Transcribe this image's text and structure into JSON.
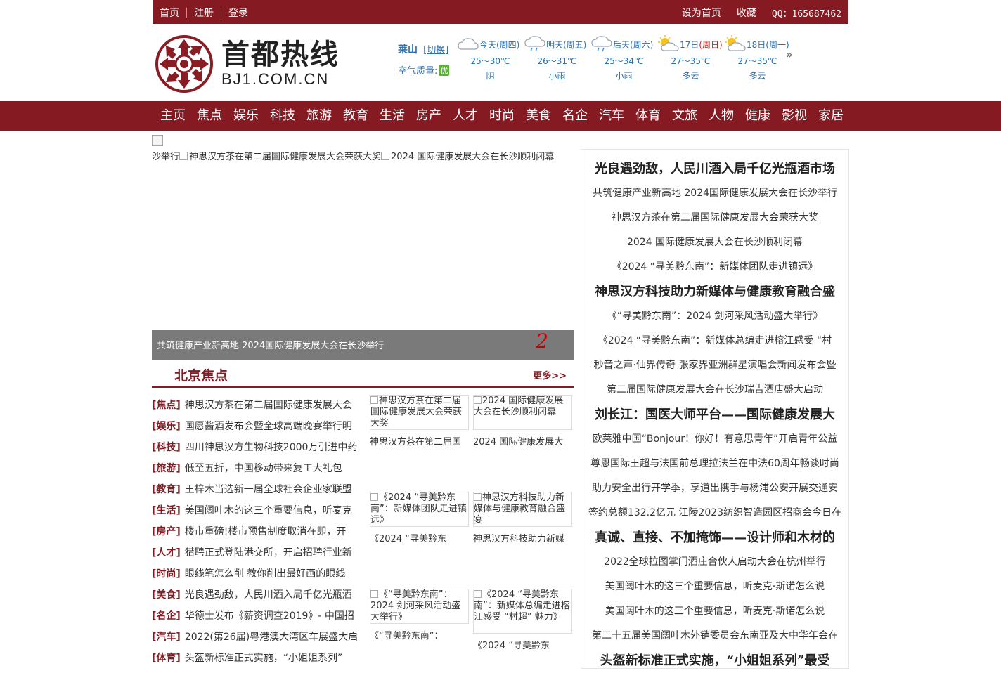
{
  "topbar": {
    "home": "首页",
    "register": "注册",
    "login": "登录",
    "set_home": "设为首页",
    "favorite": "收藏",
    "qq": "QQ：165687462"
  },
  "logo": {
    "cn": "首都热线",
    "en": "BJ1.COM.CN"
  },
  "city": {
    "name": "莱山",
    "switch": "切换",
    "aq_label": "空气质量:",
    "aq_value": "优"
  },
  "weather": [
    {
      "label": "今天(周四)",
      "temp": "25～30℃",
      "desc": "阴",
      "icon": "cloudy-icon"
    },
    {
      "label": "明天(周五)",
      "temp": "26～31℃",
      "desc": "小雨",
      "icon": "light-rain-icon"
    },
    {
      "label": "后天(周六)",
      "temp": "25～34℃",
      "desc": "小雨",
      "icon": "light-rain-icon"
    },
    {
      "label_day": "17日",
      "label_wk": "(周日)",
      "temp": "27～35℃",
      "desc": "多云",
      "icon": "partly-cloudy-icon"
    },
    {
      "label": "18日(周一)",
      "temp": "27～35℃",
      "desc": "多云",
      "icon": "partly-cloudy-icon"
    }
  ],
  "weather_more": "»",
  "nav": [
    "主页",
    "焦点",
    "娱乐",
    "科技",
    "旅游",
    "教育",
    "生活",
    "房产",
    "人才",
    "时尚",
    "美食",
    "名企",
    "汽车",
    "体育",
    "文旅",
    "人物",
    "健康",
    "影视",
    "家居"
  ],
  "slider": {
    "strip_pre": "沙举行",
    "strip_1": "神思汉方茶在第二届国际健康发展大会荣获大奖",
    "strip_2": "2024 国际健康发展大会在长沙顺利闭幕",
    "caption": "共筑健康产业新高地 2024国际健康发展大会在长沙举行",
    "index": "2"
  },
  "focus": {
    "title": "北京焦点",
    "more": "更多>>",
    "items": [
      {
        "cat": "[焦点]",
        "title": "神思汉方茶在第二届国际健康发展大会"
      },
      {
        "cat": "[娱乐]",
        "title": "国愿酱酒发布会暨全球高端晚宴举行明"
      },
      {
        "cat": "[科技]",
        "title": "四川神思汉方生物科技2000万引进中药"
      },
      {
        "cat": "[旅游]",
        "title": "低至五折，中国移动带来复工大礼包"
      },
      {
        "cat": "[教育]",
        "title": "王梓木当选新一届全球社会企业家联盟"
      },
      {
        "cat": "[生活]",
        "title": "美国阔叶木的这三个重要信息，听麦克"
      },
      {
        "cat": "[房产]",
        "title": "楼市重磅!楼市预售制度取消在即，开"
      },
      {
        "cat": "[人才]",
        "title": "猎聘正式登陆港交所，开启招聘行业新"
      },
      {
        "cat": "[时尚]",
        "title": "眼线笔怎么削 教你削出最好画的眼线"
      },
      {
        "cat": "[美食]",
        "title": "光良遇劲敌，人民川酒入局千亿光瓶酒"
      },
      {
        "cat": "[名企]",
        "title": "华德士发布《薪资调查2019》- 中国招"
      },
      {
        "cat": "[汽车]",
        "title": "2022(第26届)粤港澳大湾区车展盛大启"
      },
      {
        "cat": "[体育]",
        "title": "头盔新标准正式实施，“小姐姐系列”"
      }
    ],
    "pics": [
      {
        "alt": "神思汉方茶在第二届国际健康发展大会荣获大奖",
        "caption": "神思汉方茶在第二届国"
      },
      {
        "alt": "2024 国际健康发展大会在长沙顺利闭幕",
        "caption": "2024 国际健康发展大"
      },
      {
        "alt": "《2024 “寻美黔东南”：新媒体团队走进镇远》",
        "caption": "《2024 “寻美黔东"
      },
      {
        "alt": "神思汉方科技助力新媒体与健康教育融合盛宴",
        "caption": "神思汉方科技助力新媒"
      },
      {
        "alt": "《“寻美黔东南”：2024 剑河采风活动盛大举行》",
        "caption": "《“寻美黔东南”："
      },
      {
        "alt": "《2024 “寻美黔东南”：新媒体总编走进榕江感受 “村超” 魅力》",
        "caption": "《2024 “寻美黔东"
      }
    ]
  },
  "right_list": [
    {
      "text": "光良遇劲敌，人民川酒入局千亿光瓶酒市场",
      "big": true
    },
    {
      "text": "共筑健康产业新高地 2024国际健康发展大会在长沙举行",
      "big": false
    },
    {
      "text": "神思汉方茶在第二届国际健康发展大会荣获大奖",
      "big": false
    },
    {
      "text": "2024 国际健康发展大会在长沙顺利闭幕",
      "big": false
    },
    {
      "text": "《2024 “寻美黔东南”：新媒体团队走进镇远》",
      "big": false
    },
    {
      "text": "神思汉方科技助力新媒体与健康教育融合盛",
      "big": true
    },
    {
      "text": "《“寻美黔东南”：2024 剑河采风活动盛大举行》",
      "big": false
    },
    {
      "text": "《2024 “寻美黔东南”：新媒体总编走进榕江感受 “村",
      "big": false
    },
    {
      "text": "秒音之声·仙界传奇 张家界亚洲群星演唱会新闻发布会暨",
      "big": false
    },
    {
      "text": "第二届国际健康发展大会在长沙瑞吉酒店盛大启动",
      "big": false
    },
    {
      "text": "刘长江：国医大师平台——国际健康发展大",
      "big": true
    },
    {
      "text": "欧莱雅中国“Bonjour！你好！有意思青年”开启青年公益",
      "big": false
    },
    {
      "text": "尊恩国际王超与法国前总理拉法兰在中法60周年畅谈时尚",
      "big": false
    },
    {
      "text": "助力安全出行开学季，享道出携手与杨浦公安开展交通安",
      "big": false
    },
    {
      "text": "签约总额132.2亿元 江陵2023纺织智造园区招商会今日在",
      "big": false
    },
    {
      "text": "真诚、直接、不加掩饰——设计师和木材的",
      "big": true
    },
    {
      "text": "2022全球拉图掌门酒庄合伙人启动大会在杭州举行",
      "big": false
    },
    {
      "text": "美国阔叶木的这三个重要信息，听麦克·斯诺怎么说",
      "big": false
    },
    {
      "text": "美国阔叶木的这三个重要信息，听麦克·斯诺怎么说",
      "big": false
    },
    {
      "text": "第二十五届美国阔叶木外销委员会东南亚及大中华年会在",
      "big": false
    },
    {
      "text": "头盔新标准正式实施，“小姐姐系列”最受",
      "big": true
    }
  ]
}
